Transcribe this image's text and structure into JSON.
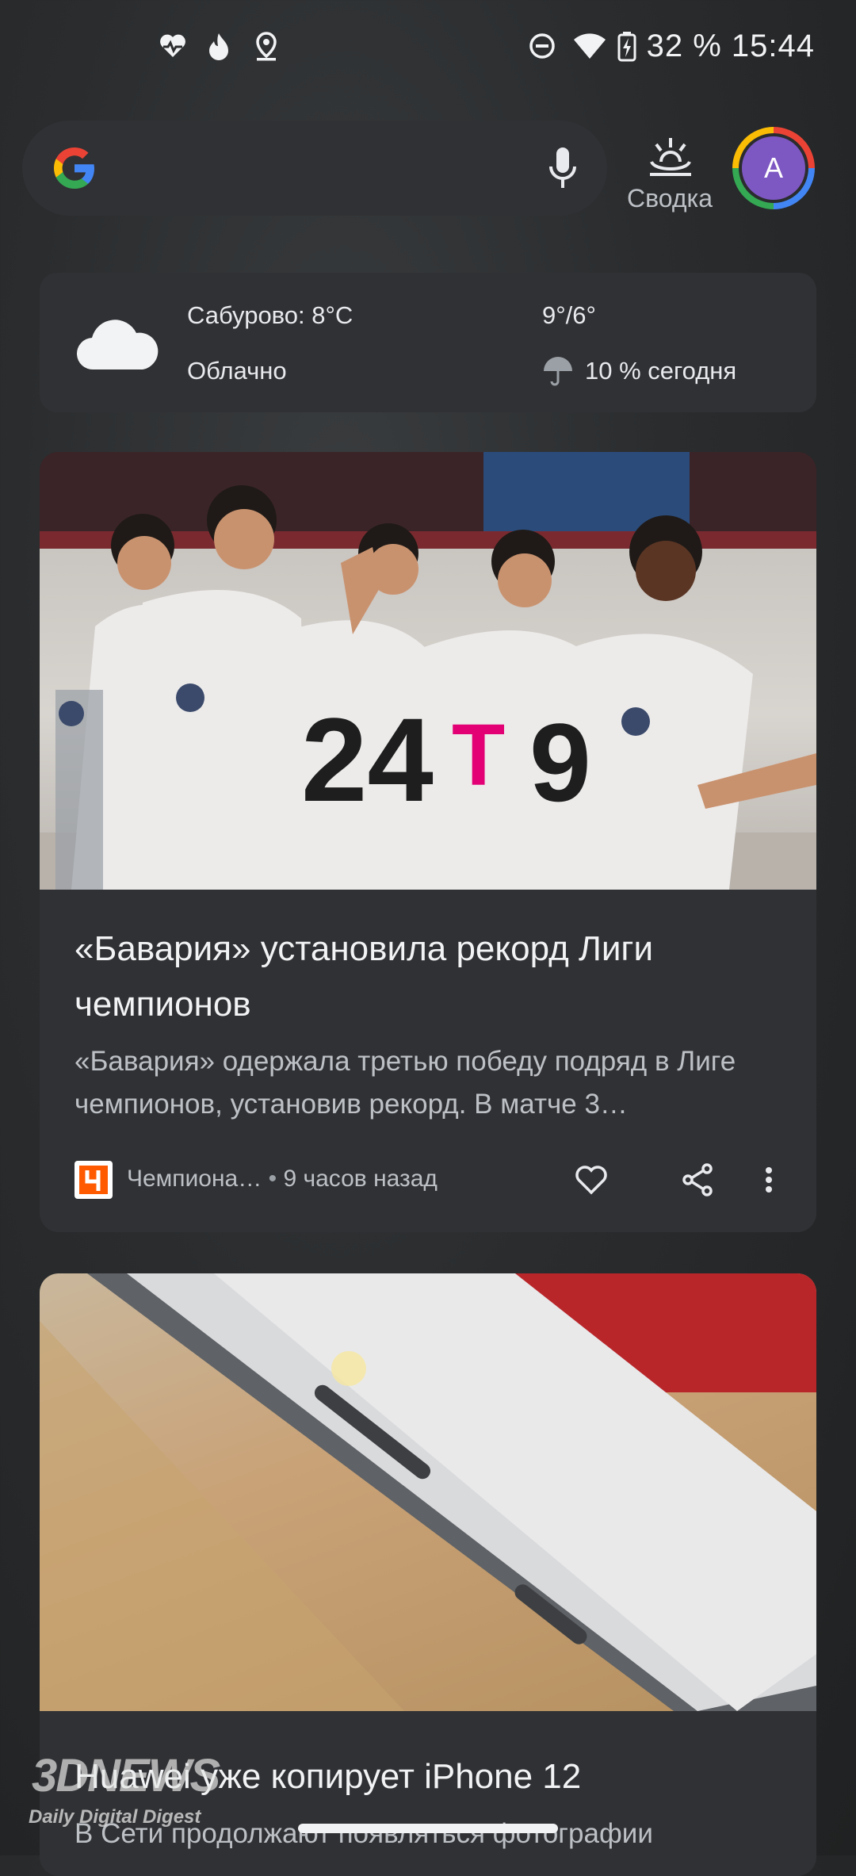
{
  "status_bar": {
    "icons": [
      "heart-pulse-icon",
      "fire-icon",
      "location-icon",
      "dnd-icon",
      "wifi-icon",
      "battery-charging-icon"
    ],
    "battery_time": "32 % 15:44"
  },
  "search": {
    "logo": "google-g-icon",
    "mic": "mic-icon"
  },
  "feed_button": {
    "label": "Сводка",
    "icon": "sunrise-icon"
  },
  "account": {
    "initial": "A"
  },
  "weather": {
    "location_temp": "Сабурово: 8°C",
    "condition": "Облачно",
    "high_low": "9°/6°",
    "precip": "10 % сегодня"
  },
  "cards": [
    {
      "title": "«Бавария» установила рекорд Лиги чемпионов",
      "description": "«Бавария» одержала третью победу подряд в Лиге чемпионов, установив рекорд. В матче 3…",
      "source": "Чемпиона…",
      "time": "9 часов назад"
    },
    {
      "title": "Huawei уже копирует iPhone 12",
      "description": "В Сети продолжают появляться фотографии"
    }
  ],
  "watermark": {
    "line1": "3DNEWS",
    "line2": "Daily Digital Digest"
  },
  "colors": {
    "card_bg": "#303134",
    "accent_purple": "#7d57c2",
    "text_primary": "#f1f3f4",
    "text_secondary": "#bdc1c6"
  }
}
